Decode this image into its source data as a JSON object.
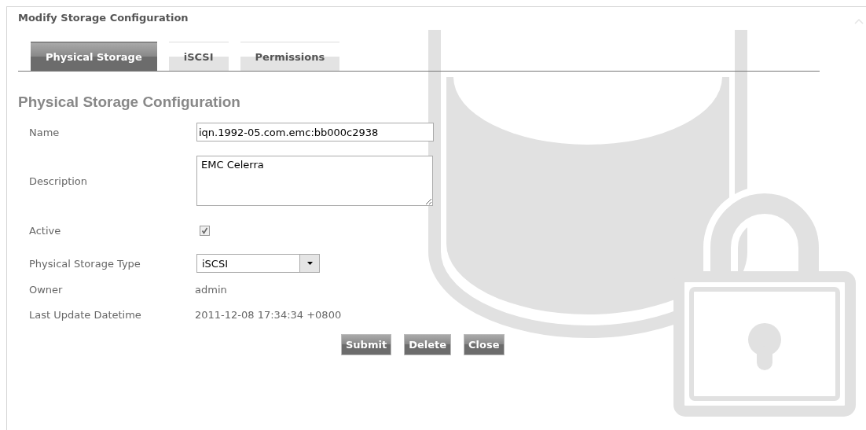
{
  "dialog": {
    "title": "Modify Storage Configuration"
  },
  "tabs": [
    {
      "label": "Physical Storage",
      "selected": true
    },
    {
      "label": "iSCSI",
      "selected": false
    },
    {
      "label": "Permissions",
      "selected": false
    }
  ],
  "heading": "Physical Storage Configuration",
  "fields": [
    {
      "kind": "text",
      "label": "Name",
      "value": "iqn.1992-05.com.emc:bb000c2938"
    },
    {
      "kind": "textarea",
      "label": "Description",
      "value": "EMC Celerra"
    },
    {
      "kind": "checkbox",
      "label": "Active",
      "checked": true
    },
    {
      "kind": "select",
      "label": "Physical Storage Type",
      "value": "iSCSI"
    },
    {
      "kind": "static",
      "label": "Owner",
      "value": "admin"
    },
    {
      "kind": "static",
      "label": "Last Update Datetime",
      "value": "2011-12-08 17:34:34 +0800"
    }
  ],
  "buttons": [
    "Submit",
    "Delete",
    "Close"
  ]
}
